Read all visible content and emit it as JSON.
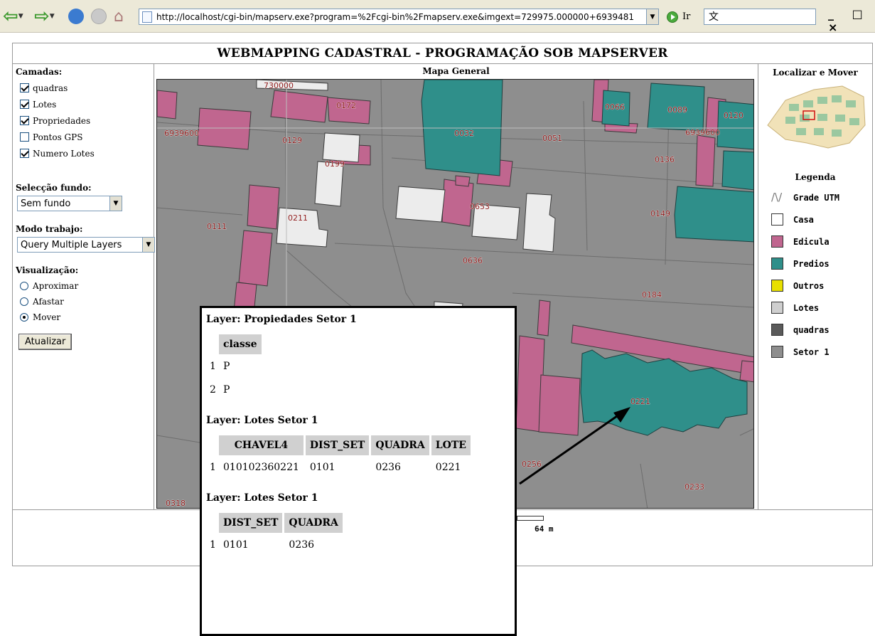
{
  "browser": {
    "url": "http://localhost/cgi-bin/mapserv.exe?program=%2Fcgi-bin%2Fmapserv.exe&imgext=729975.000000+6939481",
    "go_label": "Ir",
    "search_text": "文",
    "window_controls": "_ □ ×"
  },
  "page": {
    "title": "WEBMAPPING CADASTRAL - PROGRAMAÇÃO SOB MAPSERVER"
  },
  "sidebar": {
    "layers_title": "Camadas:",
    "layers": [
      {
        "label": "quadras",
        "checked": true
      },
      {
        "label": "Lotes",
        "checked": true
      },
      {
        "label": "Propriedades",
        "checked": true
      },
      {
        "label": "Pontos GPS",
        "checked": false
      },
      {
        "label": "Numero Lotes",
        "checked": true
      }
    ],
    "background_title": "Selecção fundo:",
    "background_value": "Sem fundo",
    "mode_title": "Modo trabajo:",
    "mode_value": "Query Multiple Layers",
    "view_title": "Visualização:",
    "view_options": [
      {
        "label": "Aproximar",
        "selected": false
      },
      {
        "label": "Afastar",
        "selected": false
      },
      {
        "label": "Mover",
        "selected": true
      }
    ],
    "update_button": "Atualizar"
  },
  "map": {
    "title": "Mapa General",
    "labels": [
      "730000",
      "0172",
      "0066",
      "0089",
      "0120",
      "6939600",
      "0129",
      "0032",
      "0051",
      "6939600",
      "0136",
      "0199",
      "0211",
      "0653",
      "0149",
      "0111",
      "0636",
      "0184",
      "0221",
      "0256",
      "0233",
      "0318"
    ],
    "scale_text": "64 m"
  },
  "right_panel": {
    "locate_title": "Localizar e Mover",
    "legend_title": "Legenda",
    "legend": [
      {
        "label": "Grade UTM",
        "color": "none"
      },
      {
        "label": "Casa",
        "color": "#ffffff"
      },
      {
        "label": "Edicula",
        "color": "#c0668f"
      },
      {
        "label": "Predios",
        "color": "#2f8f8a"
      },
      {
        "label": "Outros",
        "color": "#e8e000"
      },
      {
        "label": "Lotes",
        "color": "#cfcfcf"
      },
      {
        "label": "quadras",
        "color": "#5a5a5a"
      },
      {
        "label": "Setor 1",
        "color": "#8e8e8e"
      }
    ]
  },
  "popup": {
    "layer1_title": "Layer: Propiedades Setor 1",
    "layer1_header": "classe",
    "layer1_rows": [
      [
        "1",
        "P"
      ],
      [
        "2",
        "P"
      ]
    ],
    "layer2_title": "Layer: Lotes Setor 1",
    "layer2_headers": [
      "CHAVEL4",
      "DIST_SET",
      "QUADRA",
      "LOTE"
    ],
    "layer2_row": [
      "1",
      "010102360221",
      "0101",
      "0236",
      "0221"
    ],
    "layer3_title": "Layer: Lotes Setor 1",
    "layer3_headers": [
      "DIST_SET",
      "QUADRA"
    ],
    "layer3_row": [
      "1",
      "0101",
      "0236"
    ]
  }
}
